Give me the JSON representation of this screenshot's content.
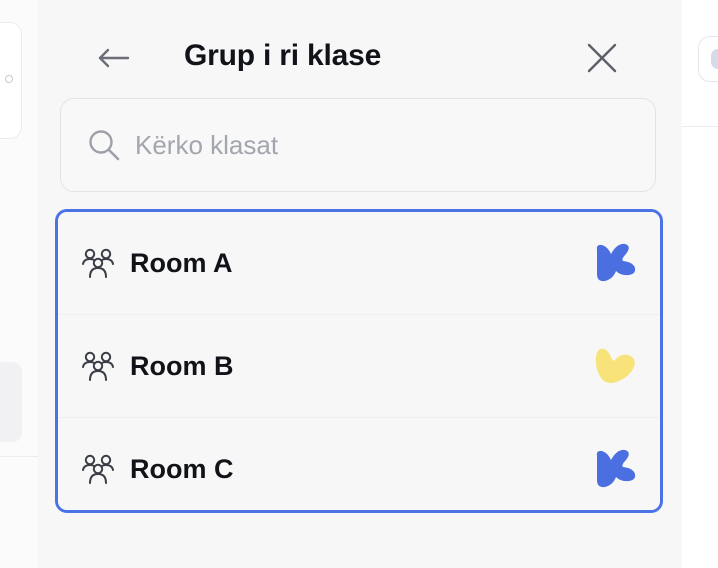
{
  "panel": {
    "title": "Grup i ri klase",
    "back_icon": "arrow-left-icon",
    "close_icon": "close-icon"
  },
  "search": {
    "placeholder": "Kërko klasat",
    "value": "",
    "icon": "search-icon"
  },
  "classes": [
    {
      "label": "Room A",
      "icon": "people-icon",
      "avatar": "blue-blob-avatar",
      "avatar_color": "#4b6fe0"
    },
    {
      "label": "Room B",
      "icon": "people-icon",
      "avatar": "yellow-heart-avatar",
      "avatar_color": "#f8e27a"
    },
    {
      "label": "Room C",
      "icon": "people-icon",
      "avatar": "blue-blob-avatar",
      "avatar_color": "#4b6fe0"
    }
  ],
  "colors": {
    "selection_border": "#4b73e6",
    "text": "#111318",
    "placeholder": "#a4a6ad"
  }
}
